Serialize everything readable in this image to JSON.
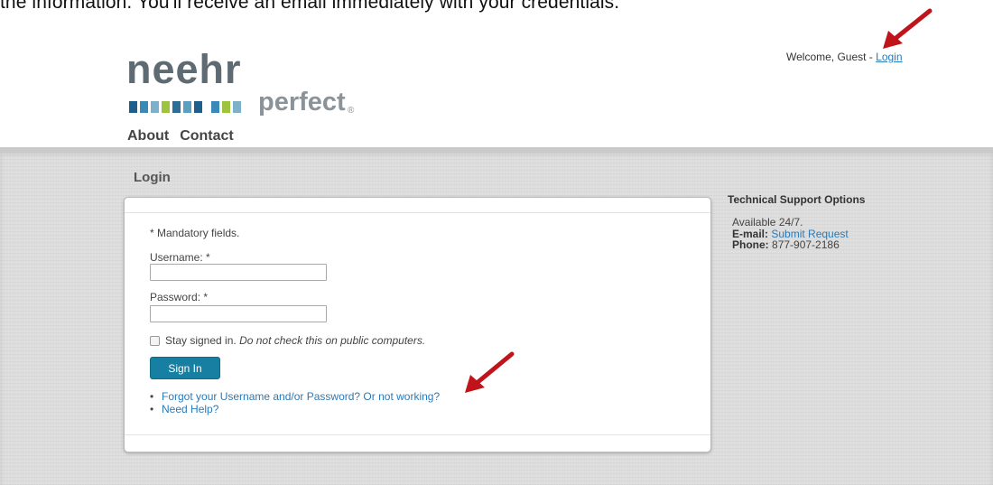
{
  "document": {
    "top_text": "the information.  You'll receive an email immediately with your credentials."
  },
  "header": {
    "welcome_text": "Welcome, Guest - ",
    "login_link": "Login",
    "logo_word": "neehr",
    "logo_sub": "perfect",
    "logo_reg": "®"
  },
  "nav": {
    "items": [
      {
        "label": "About"
      },
      {
        "label": "Contact"
      }
    ]
  },
  "main": {
    "page_title": "Login",
    "form": {
      "mandatory_note": "* Mandatory fields.",
      "username_label": "Username: *",
      "username_value": "",
      "password_label": "Password: *",
      "password_value": "",
      "stay_signed_in": "Stay signed in.",
      "stay_warning": "Do not check this on public computers.",
      "sign_in_button": "Sign In",
      "links": [
        {
          "label": "Forgot your Username and/or Password? Or not working?"
        },
        {
          "label": "Need Help?"
        }
      ]
    }
  },
  "support": {
    "title": "Technical Support Options",
    "availability": "Available 24/7.",
    "email_label": "E-mail:",
    "email_link": "Submit Request",
    "phone_label": "Phone:",
    "phone_value": "877-907-2186"
  },
  "colors": {
    "accent": "#177fa1",
    "link": "#2a7ab8",
    "annotation_arrow": "#c0141a",
    "logo_blocks": [
      "#1f5f8b",
      "#3a8ab8",
      "#7fb0c9",
      "#9cc43e",
      "#2c6e95",
      "#5aa0c2",
      "#1f5f8b",
      "#3a8ab8",
      "#9cc43e",
      "#7fb0c9",
      "#2c6e95",
      "#5aa0c2"
    ]
  }
}
